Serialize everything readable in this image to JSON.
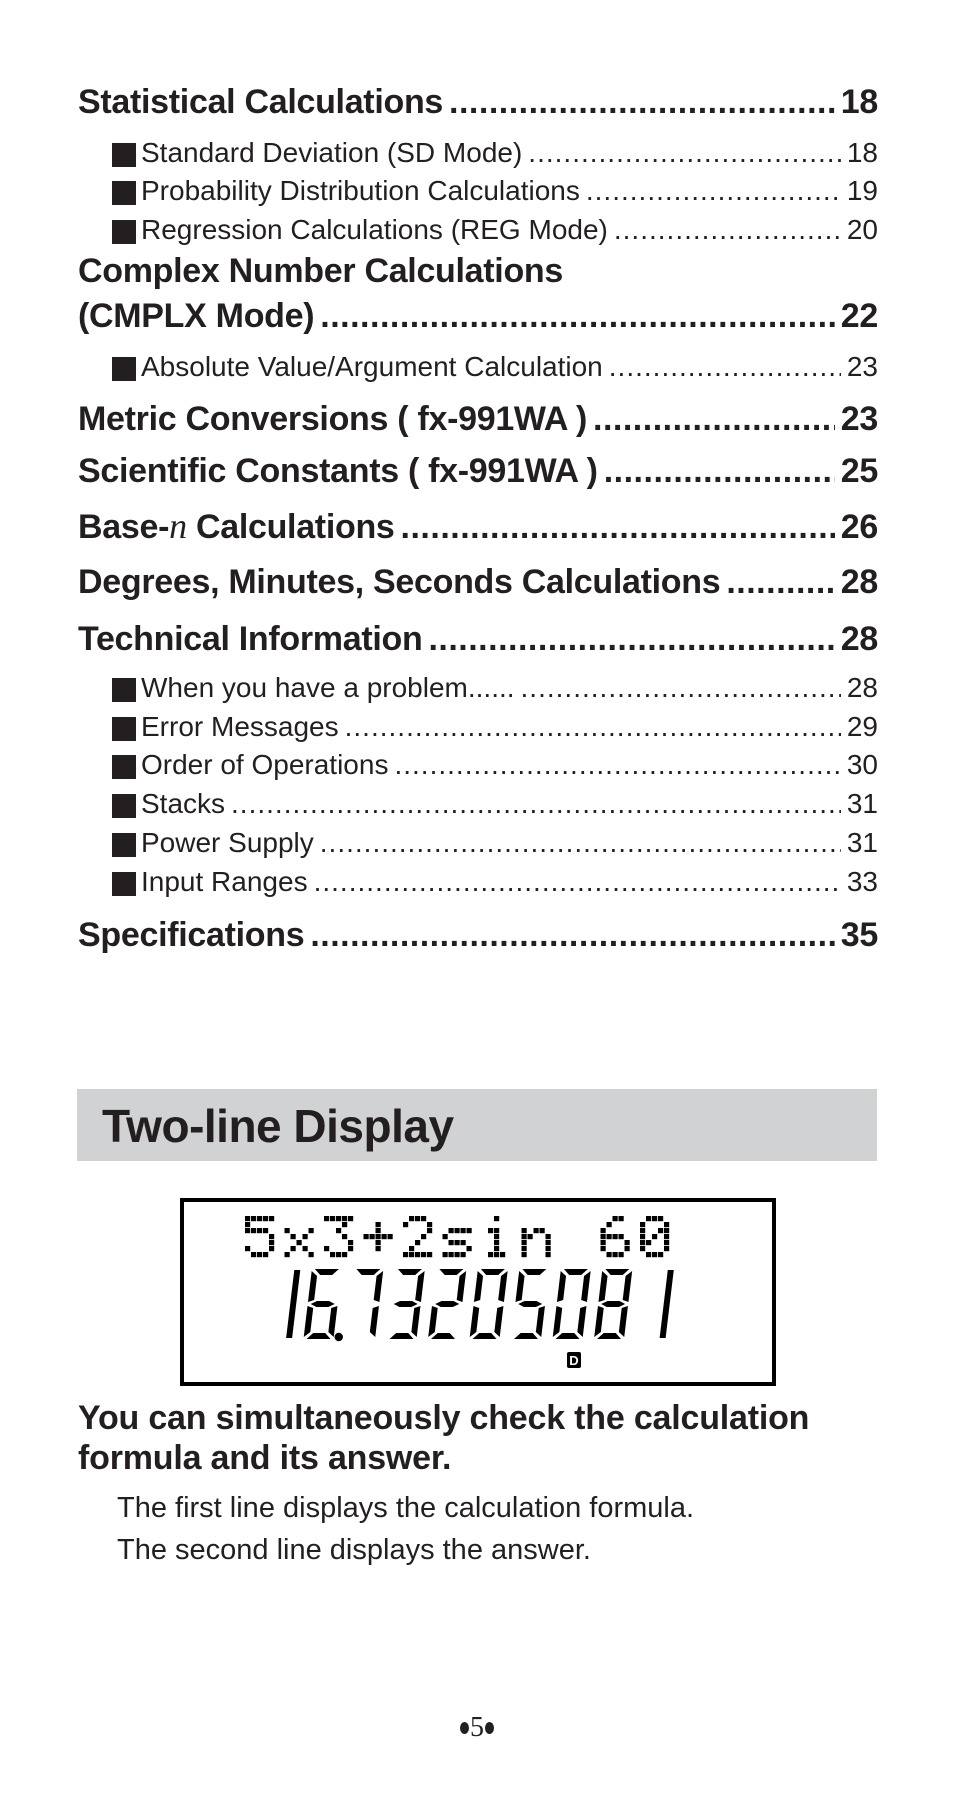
{
  "toc": {
    "entries": [
      {
        "level": "main",
        "label": "Statistical Calculations",
        "page": "18"
      },
      {
        "level": "sub",
        "label": "Standard Deviation (SD Mode)",
        "page": "18"
      },
      {
        "level": "sub",
        "label": "Probability Distribution Calculations",
        "page": "19"
      },
      {
        "level": "sub",
        "label": "Regression Calculations (REG Mode)",
        "page": "20"
      },
      {
        "level": "main-head",
        "label": "Complex Number Calculations"
      },
      {
        "level": "main",
        "label": "(CMPLX Mode)",
        "page": "22"
      },
      {
        "level": "sub",
        "label": "Absolute Value/Argument Calculation",
        "page": "23"
      },
      {
        "level": "main",
        "label": "Metric Conversions ( fx-991WA )",
        "page": "23"
      },
      {
        "level": "main",
        "label": "Scientific Constants ( fx-991WA )",
        "page": "25"
      },
      {
        "level": "main",
        "label_prefix": "Base-",
        "label_italic": "n",
        "label_suffix": " Calculations",
        "page": "26"
      },
      {
        "level": "main",
        "label": "Degrees, Minutes, Seconds Calculations",
        "page": "28"
      },
      {
        "level": "main",
        "label": "Technical Information",
        "page": "28"
      },
      {
        "level": "sub",
        "label": "When you have a problem......",
        "page": "28"
      },
      {
        "level": "sub",
        "label": "Error Messages",
        "page": "29"
      },
      {
        "level": "sub",
        "label": "Order of Operations",
        "page": "30"
      },
      {
        "level": "sub",
        "label": "Stacks",
        "page": "31"
      },
      {
        "level": "sub",
        "label": "Power Supply",
        "page": "31"
      },
      {
        "level": "sub",
        "label": "Input Ranges",
        "page": "33"
      },
      {
        "level": "main",
        "label": "Specifications",
        "page": "35"
      }
    ],
    "leader": "...................................................................................................."
  },
  "section": {
    "title": "Two-line Display",
    "bar_color": "#d1d2d4"
  },
  "display": {
    "formula": "5x3+2sin 60",
    "result": "16.73205081",
    "indicator": "D"
  },
  "description": {
    "lead": "You can simultaneously check the calculation formula and its answer.",
    "lines": [
      "The first line displays the calculation formula.",
      "The second line displays the answer."
    ]
  },
  "folio": {
    "page_number": "5"
  }
}
